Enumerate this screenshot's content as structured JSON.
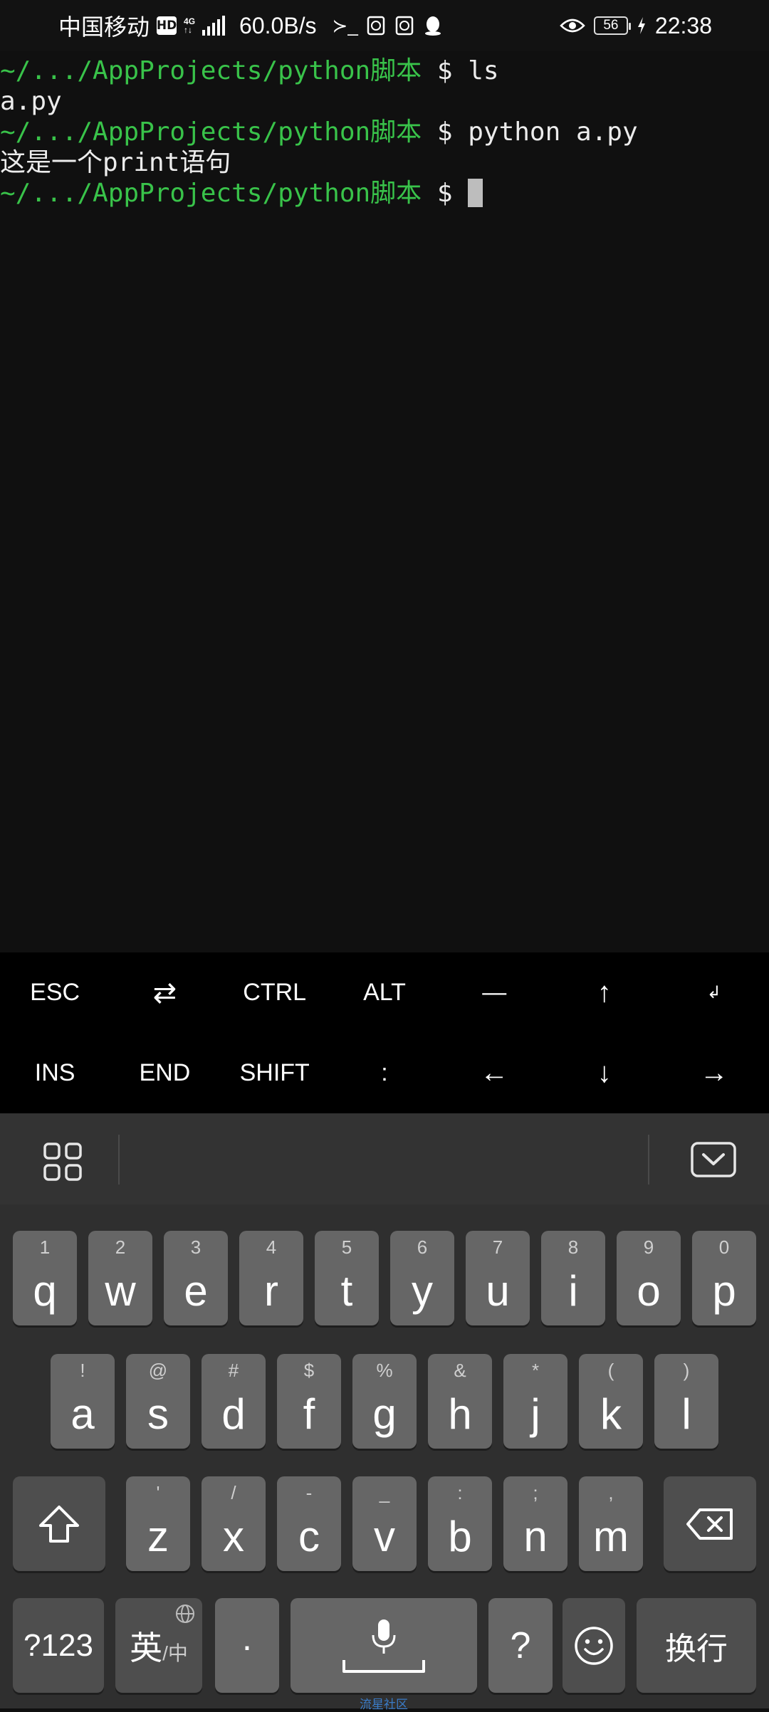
{
  "status_bar": {
    "carrier": "中国移动",
    "hd": "HD",
    "net_type_top": "4G",
    "net_type_bottom": "↑↓",
    "speed": "60.0B/s",
    "terminal_glyph": "≻_",
    "battery": "56",
    "time": "22:38",
    "icons": [
      "signal-icon",
      "terminal-icon",
      "gallery-icon",
      "gallery-icon",
      "qq-icon",
      "eye-icon",
      "battery-icon",
      "charging-icon"
    ]
  },
  "terminal": {
    "prompt_path": "~/.../AppProjects/python脚本",
    "prompt_symbol": "$",
    "lines": [
      {
        "type": "prompt",
        "cmd": "ls"
      },
      {
        "type": "output",
        "text": "a.py"
      },
      {
        "type": "prompt",
        "cmd": "python a.py"
      },
      {
        "type": "output",
        "text": "这是一个print语句"
      },
      {
        "type": "prompt",
        "cmd": ""
      }
    ],
    "colors": {
      "prompt": "#39c34a",
      "text": "#ececec",
      "background": "#101010",
      "cursor": "#bdbdbd"
    }
  },
  "extra_keys": {
    "row1": [
      "ESC",
      "⇄",
      "CTRL",
      "ALT",
      "—",
      "↑",
      "↲"
    ],
    "row2": [
      "INS",
      "END",
      "SHIFT",
      ":",
      "←",
      "↓",
      "→"
    ]
  },
  "keyboard": {
    "row1": [
      {
        "main": "q",
        "sub": "1"
      },
      {
        "main": "w",
        "sub": "2"
      },
      {
        "main": "e",
        "sub": "3"
      },
      {
        "main": "r",
        "sub": "4"
      },
      {
        "main": "t",
        "sub": "5"
      },
      {
        "main": "y",
        "sub": "6"
      },
      {
        "main": "u",
        "sub": "7"
      },
      {
        "main": "i",
        "sub": "8"
      },
      {
        "main": "o",
        "sub": "9"
      },
      {
        "main": "p",
        "sub": "0"
      }
    ],
    "row2": [
      {
        "main": "a",
        "sub": "!"
      },
      {
        "main": "s",
        "sub": "@"
      },
      {
        "main": "d",
        "sub": "#"
      },
      {
        "main": "f",
        "sub": "$"
      },
      {
        "main": "g",
        "sub": "%"
      },
      {
        "main": "h",
        "sub": "&"
      },
      {
        "main": "j",
        "sub": "*"
      },
      {
        "main": "k",
        "sub": "("
      },
      {
        "main": "l",
        "sub": ")"
      }
    ],
    "row3": [
      {
        "main": "z",
        "sub": "'"
      },
      {
        "main": "x",
        "sub": "/"
      },
      {
        "main": "c",
        "sub": "-"
      },
      {
        "main": "v",
        "sub": "_"
      },
      {
        "main": "b",
        "sub": ":"
      },
      {
        "main": "n",
        "sub": ";"
      },
      {
        "main": "m",
        "sub": ","
      }
    ],
    "row4": {
      "symbols": "?123",
      "lang_main": "英",
      "lang_sub": "/中",
      "dot": "·",
      "question": "?",
      "enter": "换行"
    },
    "brand": "流星社区",
    "colors": {
      "key": "#666666",
      "func_key": "#4e4e4e",
      "background": "#2f2f2f",
      "toolbar": "#333333"
    }
  }
}
